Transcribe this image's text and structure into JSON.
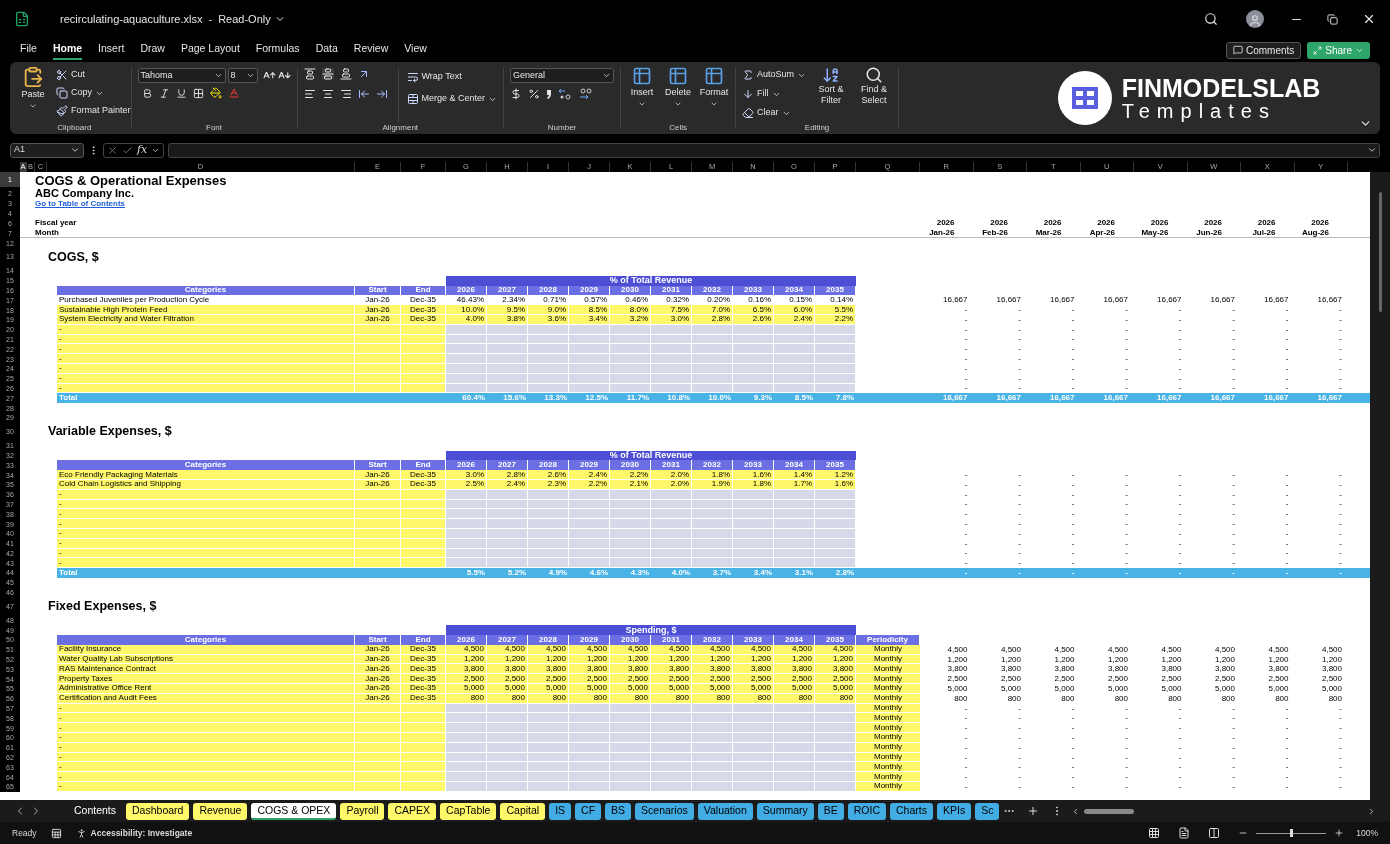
{
  "title_bar": {
    "filename": "recirculating-aquaculture.xlsx",
    "separator": "-",
    "mode": "Read-Only"
  },
  "menu": [
    {
      "label": "File",
      "selected": false
    },
    {
      "label": "Home",
      "selected": true
    },
    {
      "label": "Insert",
      "selected": false
    },
    {
      "label": "Draw",
      "selected": false
    },
    {
      "label": "Page Layout",
      "selected": false
    },
    {
      "label": "Formulas",
      "selected": false
    },
    {
      "label": "Data",
      "selected": false
    },
    {
      "label": "Review",
      "selected": false
    },
    {
      "label": "View",
      "selected": false
    }
  ],
  "actions": {
    "comments": "Comments",
    "share": "Share"
  },
  "ribbon": {
    "clipboard": {
      "label": "Clipboard",
      "paste": "Paste",
      "cut": "Cut",
      "copy": "Copy",
      "format_painter": "Format Painter"
    },
    "font": {
      "label": "Font",
      "name": "Tahoma",
      "size": "8"
    },
    "alignment": {
      "label": "Alignment",
      "wrap": "Wrap Text",
      "merge": "Merge & Center"
    },
    "number": {
      "label": "Number",
      "format": "General"
    },
    "cells": {
      "label": "Cells",
      "buttons": [
        "Insert",
        "Delete",
        "Format"
      ]
    },
    "editing": {
      "label": "Editing",
      "autosum": "AutoSum",
      "fill": "Fill",
      "clear": "Clear",
      "sort": "Sort & Filter",
      "find": "Find & Select"
    }
  },
  "logo": {
    "brand": "FINMODELSLAB",
    "sub": "Templates"
  },
  "formula_bar": {
    "name_box": "A1",
    "fx": "fx"
  },
  "columns": [
    {
      "label": "A",
      "selected": true
    },
    {
      "label": "B",
      "selected": false
    },
    {
      "label": "C",
      "selected": false
    },
    {
      "label": "D",
      "selected": false
    },
    {
      "label": "E",
      "selected": false
    },
    {
      "label": "F",
      "selected": false
    },
    {
      "label": "G",
      "selected": false
    },
    {
      "label": "H",
      "selected": false
    },
    {
      "label": "I",
      "selected": false
    },
    {
      "label": "J",
      "selected": false
    },
    {
      "label": "K",
      "selected": false
    },
    {
      "label": "L",
      "selected": false
    },
    {
      "label": "M",
      "selected": false
    },
    {
      "label": "N",
      "selected": false
    },
    {
      "label": "O",
      "selected": false
    },
    {
      "label": "P",
      "selected": false
    },
    {
      "label": "Q",
      "selected": false
    },
    {
      "label": "R",
      "selected": false
    },
    {
      "label": "S",
      "selected": false
    },
    {
      "label": "T",
      "selected": false
    },
    {
      "label": "U",
      "selected": false
    },
    {
      "label": "V",
      "selected": false
    },
    {
      "label": "W",
      "selected": false
    },
    {
      "label": "X",
      "selected": false
    },
    {
      "label": "Y",
      "selected": false
    }
  ],
  "sheet": {
    "rows": [
      {
        "n": "1",
        "kind": "title",
        "selected": true,
        "text": "COGS & Operational Expenses"
      },
      {
        "n": "2",
        "kind": "company",
        "selected": false,
        "text": "ABC Company Inc."
      },
      {
        "n": "3",
        "kind": "link",
        "selected": false,
        "text": "Go to Table of Contents"
      },
      {
        "n": "4",
        "kind": "blank",
        "selected": false
      },
      {
        "n": "6",
        "kind": "label",
        "selected": false,
        "divider": false,
        "text": "Fiscal year",
        "monthly": [
          "2026",
          "2026",
          "2026",
          "2026",
          "2026",
          "2026",
          "2026",
          "2026"
        ]
      },
      {
        "n": "7",
        "kind": "label",
        "selected": false,
        "divider": true,
        "text": "Month",
        "monthly": [
          "Jan-26",
          "Feb-26",
          "Mar-26",
          "Apr-26",
          "May-26",
          "Jun-26",
          "Jul-26",
          "Aug-26"
        ]
      },
      {
        "n": "12",
        "kind": "blank",
        "selected": false
      },
      {
        "n": "13",
        "kind": "section",
        "selected": false,
        "text": "COGS, $"
      },
      {
        "n": "14",
        "kind": "blank",
        "selected": false
      },
      {
        "n": "15",
        "kind": "band",
        "selected": false,
        "text": "% of Total Revenue"
      },
      {
        "n": "16",
        "kind": "header",
        "selected": false,
        "cells": [
          "Categories",
          "Start",
          "End",
          "2026",
          "2027",
          "2028",
          "2029",
          "2030",
          "2031",
          "2032",
          "2033",
          "2034",
          "2035"
        ]
      },
      {
        "n": "17",
        "kind": "data",
        "selected": false,
        "highlight": false,
        "name": "Purchased Juveniles per Production Cycle",
        "start": "Jan-26",
        "end": "Dec-35",
        "values": [
          "46.43%",
          "2.34%",
          "0.71%",
          "0.57%",
          "0.46%",
          "0.32%",
          "0.20%",
          "0.16%",
          "0.15%",
          "0.14%"
        ],
        "monthly": [
          "16,667",
          "16,667",
          "16,667",
          "16,667",
          "16,667",
          "16,667",
          "16,667",
          "16,667"
        ]
      },
      {
        "n": "18",
        "kind": "data",
        "selected": false,
        "highlight": true,
        "name": "Sustainable High Protein Feed",
        "start": "Jan-26",
        "end": "Dec-35",
        "values": [
          "10.0%",
          "9.5%",
          "9.0%",
          "8.5%",
          "8.0%",
          "7.5%",
          "7.0%",
          "6.5%",
          "6.0%",
          "5.5%"
        ],
        "monthly": [
          "-",
          "-",
          "-",
          "-",
          "-",
          "-",
          "-",
          "-"
        ]
      },
      {
        "n": "19",
        "kind": "data",
        "selected": false,
        "highlight": true,
        "name": "System Electricity and Water Filtration",
        "start": "Jan-26",
        "end": "Dec-35",
        "values": [
          "4.0%",
          "3.8%",
          "3.6%",
          "3.4%",
          "3.2%",
          "3.0%",
          "2.8%",
          "2.6%",
          "2.4%",
          "2.2%"
        ],
        "monthly": [
          "-",
          "-",
          "-",
          "-",
          "-",
          "-",
          "-",
          "-"
        ]
      },
      {
        "n": "20",
        "kind": "placeholder",
        "selected": false,
        "name": "-",
        "monthly": [
          "-",
          "-",
          "-",
          "-",
          "-",
          "-",
          "-",
          "-"
        ]
      },
      {
        "n": "21",
        "kind": "placeholder",
        "selected": false,
        "name": "-",
        "monthly": [
          "-",
          "-",
          "-",
          "-",
          "-",
          "-",
          "-",
          "-"
        ]
      },
      {
        "n": "22",
        "kind": "placeholder",
        "selected": false,
        "name": "-",
        "monthly": [
          "-",
          "-",
          "-",
          "-",
          "-",
          "-",
          "-",
          "-"
        ]
      },
      {
        "n": "23",
        "kind": "placeholder",
        "selected": false,
        "name": "-",
        "monthly": [
          "-",
          "-",
          "-",
          "-",
          "-",
          "-",
          "-",
          "-"
        ]
      },
      {
        "n": "24",
        "kind": "placeholder",
        "selected": false,
        "name": "-",
        "monthly": [
          "-",
          "-",
          "-",
          "-",
          "-",
          "-",
          "-",
          "-"
        ]
      },
      {
        "n": "25",
        "kind": "placeholder",
        "selected": false,
        "name": "-",
        "monthly": [
          "-",
          "-",
          "-",
          "-",
          "-",
          "-",
          "-",
          "-"
        ]
      },
      {
        "n": "26",
        "kind": "placeholder",
        "selected": false,
        "name": "-",
        "monthly": [
          "-",
          "-",
          "-",
          "-",
          "-",
          "-",
          "-",
          "-"
        ]
      },
      {
        "n": "27",
        "kind": "total",
        "selected": false,
        "name": "Total",
        "values": [
          "60.4%",
          "15.6%",
          "13.3%",
          "12.5%",
          "11.7%",
          "10.8%",
          "10.0%",
          "9.3%",
          "8.5%",
          "7.8%"
        ],
        "monthly": [
          "16,667",
          "16,667",
          "16,667",
          "16,667",
          "16,667",
          "16,667",
          "16,667",
          "16,667"
        ]
      },
      {
        "n": "28",
        "kind": "blank",
        "selected": false
      },
      {
        "n": "29",
        "kind": "blank",
        "selected": false
      },
      {
        "n": "30",
        "kind": "section",
        "selected": false,
        "text": "Variable Expenses, $"
      },
      {
        "n": "31",
        "kind": "blank",
        "selected": false
      },
      {
        "n": "32",
        "kind": "band",
        "selected": false,
        "text": "% of Total Revenue"
      },
      {
        "n": "33",
        "kind": "header",
        "selected": false,
        "cells": [
          "Categories",
          "Start",
          "End",
          "2026",
          "2027",
          "2028",
          "2029",
          "2030",
          "2031",
          "2032",
          "2033",
          "2034",
          "2035"
        ]
      },
      {
        "n": "34",
        "kind": "data",
        "selected": false,
        "highlight": true,
        "name": "Eco Friendly Packaging Materials",
        "start": "Jan-26",
        "end": "Dec-35",
        "values": [
          "3.0%",
          "2.8%",
          "2.6%",
          "2.4%",
          "2.2%",
          "2.0%",
          "1.8%",
          "1.6%",
          "1.4%",
          "1.2%"
        ],
        "monthly": [
          "-",
          "-",
          "-",
          "-",
          "-",
          "-",
          "-",
          "-"
        ]
      },
      {
        "n": "35",
        "kind": "data",
        "selected": false,
        "highlight": true,
        "name": "Cold Chain Logistics and Shipping",
        "start": "Jan-26",
        "end": "Dec-35",
        "values": [
          "2.5%",
          "2.4%",
          "2.3%",
          "2.2%",
          "2.1%",
          "2.0%",
          "1.9%",
          "1.8%",
          "1.7%",
          "1.6%"
        ],
        "monthly": [
          "-",
          "-",
          "-",
          "-",
          "-",
          "-",
          "-",
          "-"
        ]
      },
      {
        "n": "36",
        "kind": "placeholder",
        "selected": false,
        "name": "-",
        "monthly": [
          "-",
          "-",
          "-",
          "-",
          "-",
          "-",
          "-",
          "-"
        ]
      },
      {
        "n": "37",
        "kind": "placeholder",
        "selected": false,
        "name": "-",
        "monthly": [
          "-",
          "-",
          "-",
          "-",
          "-",
          "-",
          "-",
          "-"
        ]
      },
      {
        "n": "38",
        "kind": "placeholder",
        "selected": false,
        "name": "-",
        "monthly": [
          "-",
          "-",
          "-",
          "-",
          "-",
          "-",
          "-",
          "-"
        ]
      },
      {
        "n": "39",
        "kind": "placeholder",
        "selected": false,
        "name": "-",
        "monthly": [
          "-",
          "-",
          "-",
          "-",
          "-",
          "-",
          "-",
          "-"
        ]
      },
      {
        "n": "40",
        "kind": "placeholder",
        "selected": false,
        "name": "-",
        "monthly": [
          "-",
          "-",
          "-",
          "-",
          "-",
          "-",
          "-",
          "-"
        ]
      },
      {
        "n": "41",
        "kind": "placeholder",
        "selected": false,
        "name": "-",
        "monthly": [
          "-",
          "-",
          "-",
          "-",
          "-",
          "-",
          "-",
          "-"
        ]
      },
      {
        "n": "42",
        "kind": "placeholder",
        "selected": false,
        "name": "-",
        "monthly": [
          "-",
          "-",
          "-",
          "-",
          "-",
          "-",
          "-",
          "-"
        ]
      },
      {
        "n": "43",
        "kind": "placeholder",
        "selected": false,
        "name": "-",
        "monthly": [
          "-",
          "-",
          "-",
          "-",
          "-",
          "-",
          "-",
          "-"
        ]
      },
      {
        "n": "44",
        "kind": "total",
        "selected": false,
        "name": "Total",
        "values": [
          "5.5%",
          "5.2%",
          "4.9%",
          "4.6%",
          "4.3%",
          "4.0%",
          "3.7%",
          "3.4%",
          "3.1%",
          "2.8%"
        ],
        "monthly": [
          "-",
          "-",
          "-",
          "-",
          "-",
          "-",
          "-",
          "-"
        ]
      },
      {
        "n": "45",
        "kind": "blank",
        "selected": false
      },
      {
        "n": "46",
        "kind": "blank",
        "selected": false
      },
      {
        "n": "47",
        "kind": "section",
        "selected": false,
        "text": "Fixed Expenses, $"
      },
      {
        "n": "48",
        "kind": "blank",
        "selected": false
      },
      {
        "n": "49",
        "kind": "band",
        "selected": false,
        "text": "Spending, $"
      },
      {
        "n": "50",
        "kind": "header",
        "selected": false,
        "cells": [
          "Categories",
          "Start",
          "End",
          "2026",
          "2027",
          "2028",
          "2029",
          "2030",
          "2031",
          "2032",
          "2033",
          "2034",
          "2035",
          "Periodicity"
        ]
      },
      {
        "n": "51",
        "kind": "data",
        "selected": false,
        "highlight": true,
        "name": "Facility Insurance",
        "start": "Jan-26",
        "end": "Dec-35",
        "values": [
          "4,500",
          "4,500",
          "4,500",
          "4,500",
          "4,500",
          "4,500",
          "4,500",
          "4,500",
          "4,500",
          "4,500"
        ],
        "periodicity": "Monthly",
        "monthly": [
          "4,500",
          "4,500",
          "4,500",
          "4,500",
          "4,500",
          "4,500",
          "4,500",
          "4,500"
        ]
      },
      {
        "n": "52",
        "kind": "data",
        "selected": false,
        "highlight": true,
        "name": "Water Quality Lab Subscriptions",
        "start": "Jan-26",
        "end": "Dec-35",
        "values": [
          "1,200",
          "1,200",
          "1,200",
          "1,200",
          "1,200",
          "1,200",
          "1,200",
          "1,200",
          "1,200",
          "1,200"
        ],
        "periodicity": "Monthly",
        "monthly": [
          "1,200",
          "1,200",
          "1,200",
          "1,200",
          "1,200",
          "1,200",
          "1,200",
          "1,200"
        ]
      },
      {
        "n": "53",
        "kind": "data",
        "selected": false,
        "highlight": true,
        "name": "RAS Maintenance Contract",
        "start": "Jan-26",
        "end": "Dec-35",
        "values": [
          "3,800",
          "3,800",
          "3,800",
          "3,800",
          "3,800",
          "3,800",
          "3,800",
          "3,800",
          "3,800",
          "3,800"
        ],
        "periodicity": "Monthly",
        "monthly": [
          "3,800",
          "3,800",
          "3,800",
          "3,800",
          "3,800",
          "3,800",
          "3,800",
          "3,800"
        ]
      },
      {
        "n": "54",
        "kind": "data",
        "selected": false,
        "highlight": true,
        "name": "Property Taxes",
        "start": "Jan-26",
        "end": "Dec-35",
        "values": [
          "2,500",
          "2,500",
          "2,500",
          "2,500",
          "2,500",
          "2,500",
          "2,500",
          "2,500",
          "2,500",
          "2,500"
        ],
        "periodicity": "Monthly",
        "monthly": [
          "2,500",
          "2,500",
          "2,500",
          "2,500",
          "2,500",
          "2,500",
          "2,500",
          "2,500"
        ]
      },
      {
        "n": "55",
        "kind": "data",
        "selected": false,
        "highlight": true,
        "name": "Administrative Office Rent",
        "start": "Jan-26",
        "end": "Dec-35",
        "values": [
          "5,000",
          "5,000",
          "5,000",
          "5,000",
          "5,000",
          "5,000",
          "5,000",
          "5,000",
          "5,000",
          "5,000"
        ],
        "periodicity": "Monthly",
        "monthly": [
          "5,000",
          "5,000",
          "5,000",
          "5,000",
          "5,000",
          "5,000",
          "5,000",
          "5,000"
        ]
      },
      {
        "n": "56",
        "kind": "data",
        "selected": false,
        "highlight": true,
        "name": "Certification and Audit Fees",
        "start": "Jan-26",
        "end": "Dec-35",
        "values": [
          "800",
          "800",
          "800",
          "800",
          "800",
          "800",
          "800",
          "800",
          "800",
          "800"
        ],
        "periodicity": "Monthly",
        "monthly": [
          "800",
          "800",
          "800",
          "800",
          "800",
          "800",
          "800",
          "800"
        ]
      },
      {
        "n": "57",
        "kind": "placeholder",
        "selected": false,
        "name": "-",
        "periodicity": "Monthly",
        "monthly": [
          "-",
          "-",
          "-",
          "-",
          "-",
          "-",
          "-",
          "-"
        ]
      },
      {
        "n": "58",
        "kind": "placeholder",
        "selected": false,
        "name": "-",
        "periodicity": "Monthly",
        "monthly": [
          "-",
          "-",
          "-",
          "-",
          "-",
          "-",
          "-",
          "-"
        ]
      },
      {
        "n": "59",
        "kind": "placeholder",
        "selected": false,
        "name": "-",
        "periodicity": "Monthly",
        "monthly": [
          "-",
          "-",
          "-",
          "-",
          "-",
          "-",
          "-",
          "-"
        ]
      },
      {
        "n": "60",
        "kind": "placeholder",
        "selected": false,
        "name": "-",
        "periodicity": "Monthly",
        "monthly": [
          "-",
          "-",
          "-",
          "-",
          "-",
          "-",
          "-",
          "-"
        ]
      },
      {
        "n": "61",
        "kind": "placeholder",
        "selected": false,
        "name": "-",
        "periodicity": "Monthly",
        "monthly": [
          "-",
          "-",
          "-",
          "-",
          "-",
          "-",
          "-",
          "-"
        ]
      },
      {
        "n": "62",
        "kind": "placeholder",
        "selected": false,
        "name": "-",
        "periodicity": "Monthly",
        "monthly": [
          "-",
          "-",
          "-",
          "-",
          "-",
          "-",
          "-",
          "-"
        ]
      },
      {
        "n": "63",
        "kind": "placeholder",
        "selected": false,
        "name": "-",
        "periodicity": "Monthly",
        "monthly": [
          "-",
          "-",
          "-",
          "-",
          "-",
          "-",
          "-",
          "-"
        ]
      },
      {
        "n": "64",
        "kind": "placeholder",
        "selected": false,
        "name": "-",
        "periodicity": "Monthly",
        "monthly": [
          "-",
          "-",
          "-",
          "-",
          "-",
          "-",
          "-",
          "-"
        ]
      },
      {
        "n": "65",
        "kind": "placeholder",
        "selected": false,
        "name": "-",
        "periodicity": "Monthly",
        "monthly": [
          "-",
          "-",
          "-",
          "-",
          "-",
          "-",
          "-",
          "-"
        ]
      }
    ]
  },
  "sheet_tabs": [
    {
      "label": "Contents",
      "selected": false
    },
    {
      "label": "Dashboard",
      "selected": false,
      "color": "#fff86b"
    },
    {
      "label": "Revenue",
      "selected": false,
      "color": "#fff86b"
    },
    {
      "label": "COGS & OPEX",
      "selected": true
    },
    {
      "label": "Payroll",
      "selected": false,
      "color": "#fff86b"
    },
    {
      "label": "CAPEX",
      "selected": false,
      "color": "#fff86b"
    },
    {
      "label": "CapTable",
      "selected": false,
      "color": "#fff86b"
    },
    {
      "label": "Capital",
      "selected": false,
      "color": "#fff86b"
    },
    {
      "label": "IS",
      "selected": false,
      "color": "#42ade4"
    },
    {
      "label": "CF",
      "selected": false,
      "color": "#42ade4"
    },
    {
      "label": "BS",
      "selected": false,
      "color": "#42ade4"
    },
    {
      "label": "Scenarios",
      "selected": false,
      "color": "#42ade4"
    },
    {
      "label": "Valuation",
      "selected": false,
      "color": "#42ade4"
    },
    {
      "label": "Summary",
      "selected": false,
      "color": "#42ade4"
    },
    {
      "label": "BE",
      "selected": false,
      "color": "#42ade4"
    },
    {
      "label": "ROIC",
      "selected": false,
      "color": "#42ade4"
    },
    {
      "label": "Charts",
      "selected": false,
      "color": "#42ade4"
    },
    {
      "label": "KPIs",
      "selected": false,
      "color": "#42ade4"
    },
    {
      "label": "Sc",
      "selected": false,
      "color": "#42ade4"
    }
  ],
  "status_bar": {
    "ready": "Ready",
    "accessibility": "Accessibility: Investigate",
    "zoom": {
      "level": 0.5,
      "reading": "100%"
    }
  }
}
